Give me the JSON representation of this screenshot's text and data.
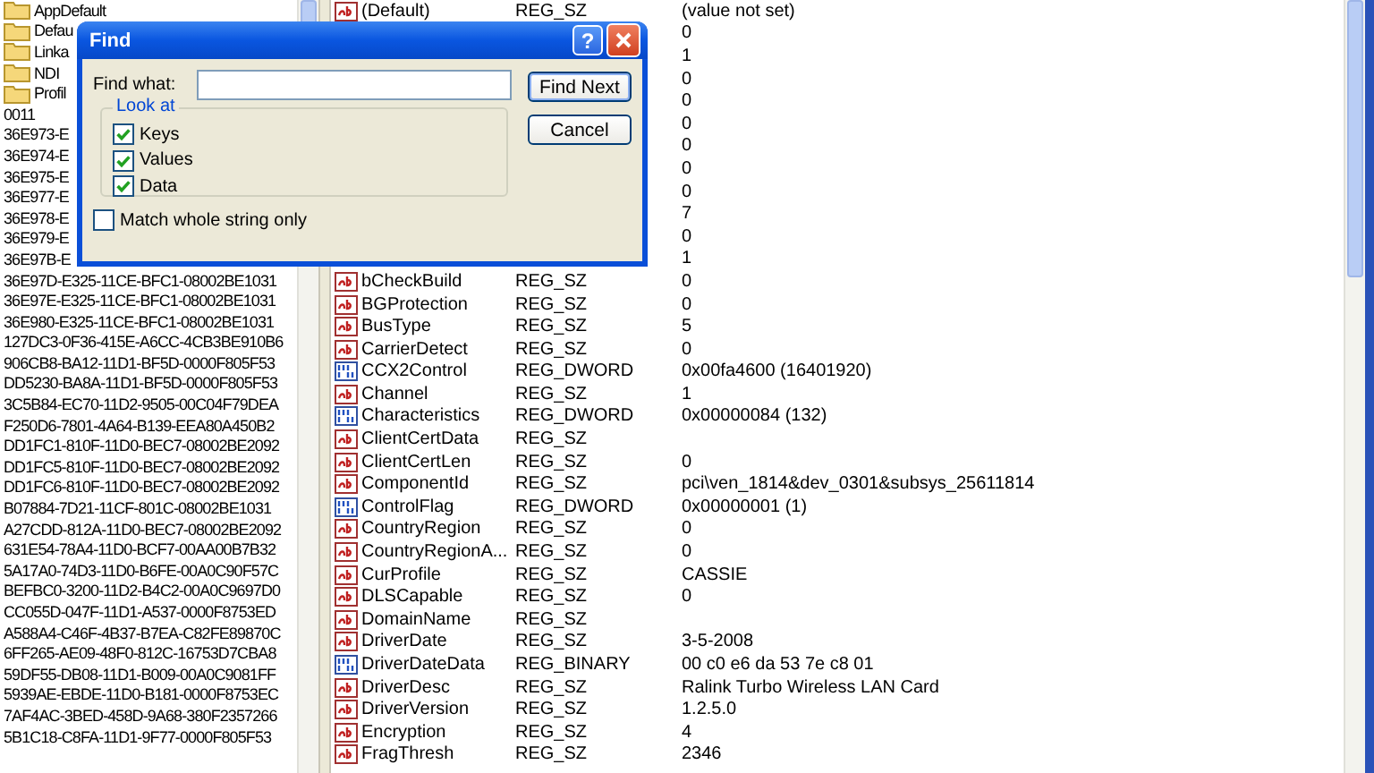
{
  "tree": {
    "items": [
      {
        "label": "AppDefault",
        "kind": "folder"
      },
      {
        "label": "Defau",
        "kind": "folder"
      },
      {
        "label": "Linka",
        "kind": "folder"
      },
      {
        "label": "NDI",
        "kind": "folder"
      },
      {
        "label": "Profil",
        "kind": "folder"
      },
      {
        "label": "0011",
        "kind": "key"
      },
      {
        "label": "36E973-E",
        "kind": "key"
      },
      {
        "label": "36E974-E",
        "kind": "key"
      },
      {
        "label": "36E975-E",
        "kind": "key"
      },
      {
        "label": "36E977-E",
        "kind": "key"
      },
      {
        "label": "36E978-E",
        "kind": "key"
      },
      {
        "label": "36E979-E",
        "kind": "key"
      },
      {
        "label": "36E97B-E",
        "kind": "key"
      },
      {
        "label": "36E97D-E325-11CE-BFC1-08002BE1031",
        "kind": "key"
      },
      {
        "label": "36E97E-E325-11CE-BFC1-08002BE1031",
        "kind": "key"
      },
      {
        "label": "36E980-E325-11CE-BFC1-08002BE1031",
        "kind": "key"
      },
      {
        "label": "127DC3-0F36-415E-A6CC-4CB3BE910B6",
        "kind": "key"
      },
      {
        "label": "906CB8-BA12-11D1-BF5D-0000F805F53",
        "kind": "key"
      },
      {
        "label": "DD5230-BA8A-11D1-BF5D-0000F805F53",
        "kind": "key"
      },
      {
        "label": "3C5B84-EC70-11D2-9505-00C04F79DEA",
        "kind": "key"
      },
      {
        "label": "F250D6-7801-4A64-B139-EEA80A450B2",
        "kind": "key"
      },
      {
        "label": "DD1FC1-810F-11D0-BEC7-08002BE2092",
        "kind": "key"
      },
      {
        "label": "DD1FC5-810F-11D0-BEC7-08002BE2092",
        "kind": "key"
      },
      {
        "label": "DD1FC6-810F-11D0-BEC7-08002BE2092",
        "kind": "key"
      },
      {
        "label": "B07884-7D21-11CF-801C-08002BE1031",
        "kind": "key"
      },
      {
        "label": "A27CDD-812A-11D0-BEC7-08002BE2092",
        "kind": "key"
      },
      {
        "label": "631E54-78A4-11D0-BCF7-00AA00B7B32",
        "kind": "key"
      },
      {
        "label": "5A17A0-74D3-11D0-B6FE-00A0C90F57C",
        "kind": "key"
      },
      {
        "label": "BEFBC0-3200-11D2-B4C2-00A0C9697D0",
        "kind": "key"
      },
      {
        "label": "CC055D-047F-11D1-A537-0000F8753ED",
        "kind": "key"
      },
      {
        "label": "A588A4-C46F-4B37-B7EA-C82FE89870C",
        "kind": "key"
      },
      {
        "label": "6FF265-AE09-48F0-812C-16753D7CBA8",
        "kind": "key"
      },
      {
        "label": "59DF55-DB08-11D1-B009-00A0C9081FF",
        "kind": "key"
      },
      {
        "label": "5939AE-EBDE-11D0-B181-0000F8753EC",
        "kind": "key"
      },
      {
        "label": "7AF4AC-3BED-458D-9A68-380F2357266",
        "kind": "key"
      },
      {
        "label": "5B1C18-C8FA-11D1-9F77-0000F805F53",
        "kind": "key"
      }
    ]
  },
  "values": {
    "rows": [
      {
        "kind": "string",
        "name": "(Default)",
        "type": "REG_SZ",
        "data": "(value not set)"
      },
      {
        "data": "0"
      },
      {
        "data": "1"
      },
      {
        "data": "0"
      },
      {
        "data": "0"
      },
      {
        "data": "0"
      },
      {
        "data": "0"
      },
      {
        "data": "0"
      },
      {
        "data": "0"
      },
      {
        "data": "7"
      },
      {
        "data": "0"
      },
      {
        "data": "1"
      },
      {
        "kind": "string",
        "name": "bCheckBuild",
        "type": "REG_SZ",
        "data": "0"
      },
      {
        "kind": "string",
        "name": "BGProtection",
        "type": "REG_SZ",
        "data": "0"
      },
      {
        "kind": "string",
        "name": "BusType",
        "type": "REG_SZ",
        "data": "5"
      },
      {
        "kind": "string",
        "name": "CarrierDetect",
        "type": "REG_SZ",
        "data": "0"
      },
      {
        "kind": "binary",
        "name": "CCX2Control",
        "type": "REG_DWORD",
        "data": "0x00fa4600 (16401920)"
      },
      {
        "kind": "string",
        "name": "Channel",
        "type": "REG_SZ",
        "data": "1"
      },
      {
        "kind": "binary",
        "name": "Characteristics",
        "type": "REG_DWORD",
        "data": "0x00000084 (132)"
      },
      {
        "kind": "string",
        "name": "ClientCertData",
        "type": "REG_SZ"
      },
      {
        "kind": "string",
        "name": "ClientCertLen",
        "type": "REG_SZ",
        "data": "0"
      },
      {
        "kind": "string",
        "name": "ComponentId",
        "type": "REG_SZ",
        "data": "pci\\ven_1814&dev_0301&subsys_25611814"
      },
      {
        "kind": "binary",
        "name": "ControlFlag",
        "type": "REG_DWORD",
        "data": "0x00000001 (1)"
      },
      {
        "kind": "string",
        "name": "CountryRegion",
        "type": "REG_SZ",
        "data": "0"
      },
      {
        "kind": "string",
        "name": "CountryRegionA...",
        "type": "REG_SZ",
        "data": "0"
      },
      {
        "kind": "string",
        "name": "CurProfile",
        "type": "REG_SZ",
        "data": "CASSIE"
      },
      {
        "kind": "string",
        "name": "DLSCapable",
        "type": "REG_SZ",
        "data": "0"
      },
      {
        "kind": "string",
        "name": "DomainName",
        "type": "REG_SZ"
      },
      {
        "kind": "string",
        "name": "DriverDate",
        "type": "REG_SZ",
        "data": "3-5-2008"
      },
      {
        "kind": "binary",
        "name": "DriverDateData",
        "type": "REG_BINARY",
        "data": "00 c0 e6 da 53 7e c8 01"
      },
      {
        "kind": "string",
        "name": "DriverDesc",
        "type": "REG_SZ",
        "data": "Ralink Turbo Wireless LAN Card"
      },
      {
        "kind": "string",
        "name": "DriverVersion",
        "type": "REG_SZ",
        "data": "1.2.5.0"
      },
      {
        "kind": "string",
        "name": "Encryption",
        "type": "REG_SZ",
        "data": "4"
      },
      {
        "kind": "string",
        "name": "FragThresh",
        "type": "REG_SZ",
        "data": "2346"
      }
    ]
  },
  "find_dialog": {
    "title": "Find",
    "help_button": "?",
    "find_what": {
      "label": "Find what:"
    },
    "look_at": {
      "title": "Look at",
      "options": [
        {
          "label": "Keys",
          "checked": true
        },
        {
          "label": "Values",
          "checked": true
        },
        {
          "label": "Data",
          "checked": true
        }
      ]
    },
    "match_whole": {
      "label": "Match whole string only",
      "checked": false
    },
    "buttons": [
      "Find Next",
      "Cancel"
    ]
  }
}
